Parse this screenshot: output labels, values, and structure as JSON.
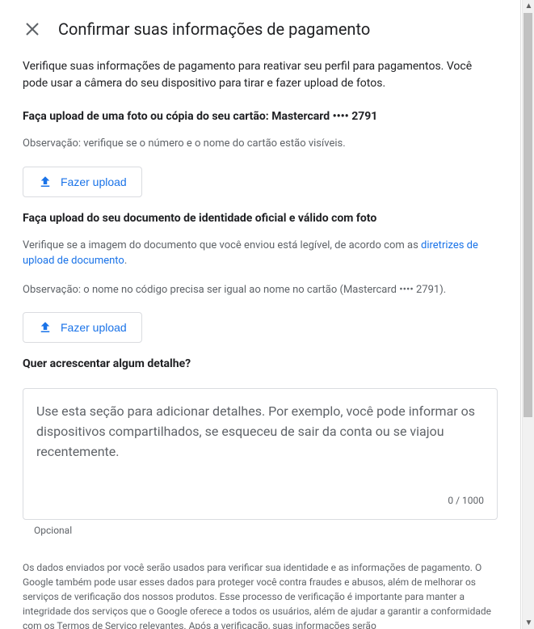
{
  "header": {
    "title": "Confirmar suas informações de pagamento"
  },
  "intro": "Verifique suas informações de pagamento para reativar seu perfil para pagamentos. Você pode usar a câmera do seu dispositivo para tirar e fazer upload de fotos.",
  "section1": {
    "heading": "Faça upload de uma foto ou cópia do seu cartão: Mastercard •••• 2791",
    "note": "Observação: verifique se o número e o nome do cartão estão visíveis.",
    "upload_label": "Fazer upload"
  },
  "section2": {
    "heading": "Faça upload do seu documento de identidade oficial e válido com foto",
    "verify_prefix": "Verifique se a imagem do documento que você enviou está legível, de acordo com as ",
    "link_text": "diretrizes de upload de documento",
    "verify_suffix": ".",
    "note": "Observação: o nome no código precisa ser igual ao nome no cartão (Mastercard •••• 2791).",
    "upload_label": "Fazer upload"
  },
  "section3": {
    "heading": "Quer acrescentar algum detalhe?",
    "placeholder": "Use esta seção para adicionar detalhes. Por exemplo, você pode informar os dispositivos compartilhados, se esqueceu de sair da conta ou se viajou recentemente.",
    "counter": "0 / 1000",
    "optional": "Opcional"
  },
  "legal": "Os dados enviados por você serão usados para verificar sua identidade e as informações de pagamento. O Google também pode usar esses dados para proteger você contra fraudes e abusos, além de melhorar os serviços de verificação dos nossos produtos. Esse processo de verificação é importante para manter a integridade dos serviços que o Google oferece a todos os usuários, além de ajudar a garantir a conformidade com os Termos de Serviço relevantes. Após a verificação, suas informações serão"
}
